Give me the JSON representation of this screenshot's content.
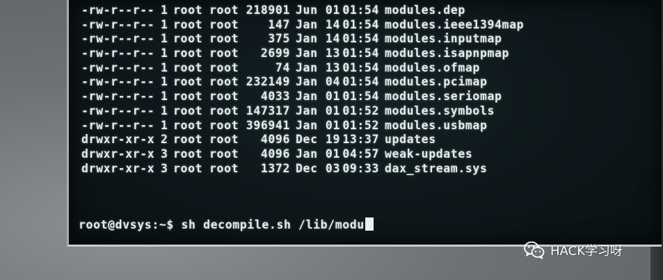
{
  "terminal": {
    "listing": [
      {
        "perms": "-rw-r--r--",
        "links": "1",
        "owner": "root",
        "group": "root",
        "size": "218901",
        "month": "Jun",
        "day": "01",
        "time": "01:54",
        "name": "modules.dep"
      },
      {
        "perms": "-rw-r--r--",
        "links": "1",
        "owner": "root",
        "group": "root",
        "size": "147",
        "month": "Jan",
        "day": "14",
        "time": "01:54",
        "name": "modules.ieee1394map"
      },
      {
        "perms": "-rw-r--r--",
        "links": "1",
        "owner": "root",
        "group": "root",
        "size": "375",
        "month": "Jan",
        "day": "14",
        "time": "01:54",
        "name": "modules.inputmap"
      },
      {
        "perms": "-rw-r--r--",
        "links": "1",
        "owner": "root",
        "group": "root",
        "size": "2699",
        "month": "Jan",
        "day": "13",
        "time": "01:54",
        "name": "modules.isapnpmap"
      },
      {
        "perms": "-rw-r--r--",
        "links": "1",
        "owner": "root",
        "group": "root",
        "size": "74",
        "month": "Jan",
        "day": "13",
        "time": "01:54",
        "name": "modules.ofmap"
      },
      {
        "perms": "-rw-r--r--",
        "links": "1",
        "owner": "root",
        "group": "root",
        "size": "232149",
        "month": "Jan",
        "day": "04",
        "time": "01:54",
        "name": "modules.pcimap"
      },
      {
        "perms": "-rw-r--r--",
        "links": "1",
        "owner": "root",
        "group": "root",
        "size": "4033",
        "month": "Jan",
        "day": "01",
        "time": "01:54",
        "name": "modules.seriomap"
      },
      {
        "perms": "-rw-r--r--",
        "links": "1",
        "owner": "root",
        "group": "root",
        "size": "147317",
        "month": "Jan",
        "day": "01",
        "time": "01:52",
        "name": "modules.symbols"
      },
      {
        "perms": "-rw-r--r--",
        "links": "1",
        "owner": "root",
        "group": "root",
        "size": "396941",
        "month": "Jan",
        "day": "01",
        "time": "01:52",
        "name": "modules.usbmap"
      },
      {
        "perms": "drwxr-xr-x",
        "links": "2",
        "owner": "root",
        "group": "root",
        "size": "4096",
        "month": "Dec",
        "day": "19",
        "time": "13:37",
        "name": "updates"
      },
      {
        "perms": "drwxr-xr-x",
        "links": "3",
        "owner": "root",
        "group": "root",
        "size": "4096",
        "month": "Jan",
        "day": "01",
        "time": "04:57",
        "name": "weak-updates"
      },
      {
        "perms": "drwxr-xr-x",
        "links": "3",
        "owner": "root",
        "group": "root",
        "size": "1372",
        "month": "Dec",
        "day": "03",
        "time": "09:33",
        "name": "dax_stream.sys"
      }
    ],
    "prompt": "root@dvsys:~$",
    "command": "sh decompile.sh /lib/modu"
  },
  "watermark": {
    "text": "HACK学习呀",
    "icon": "wechat-icon"
  },
  "colors": {
    "screen_bg": "#0c1518",
    "text": "#e6ecec"
  }
}
